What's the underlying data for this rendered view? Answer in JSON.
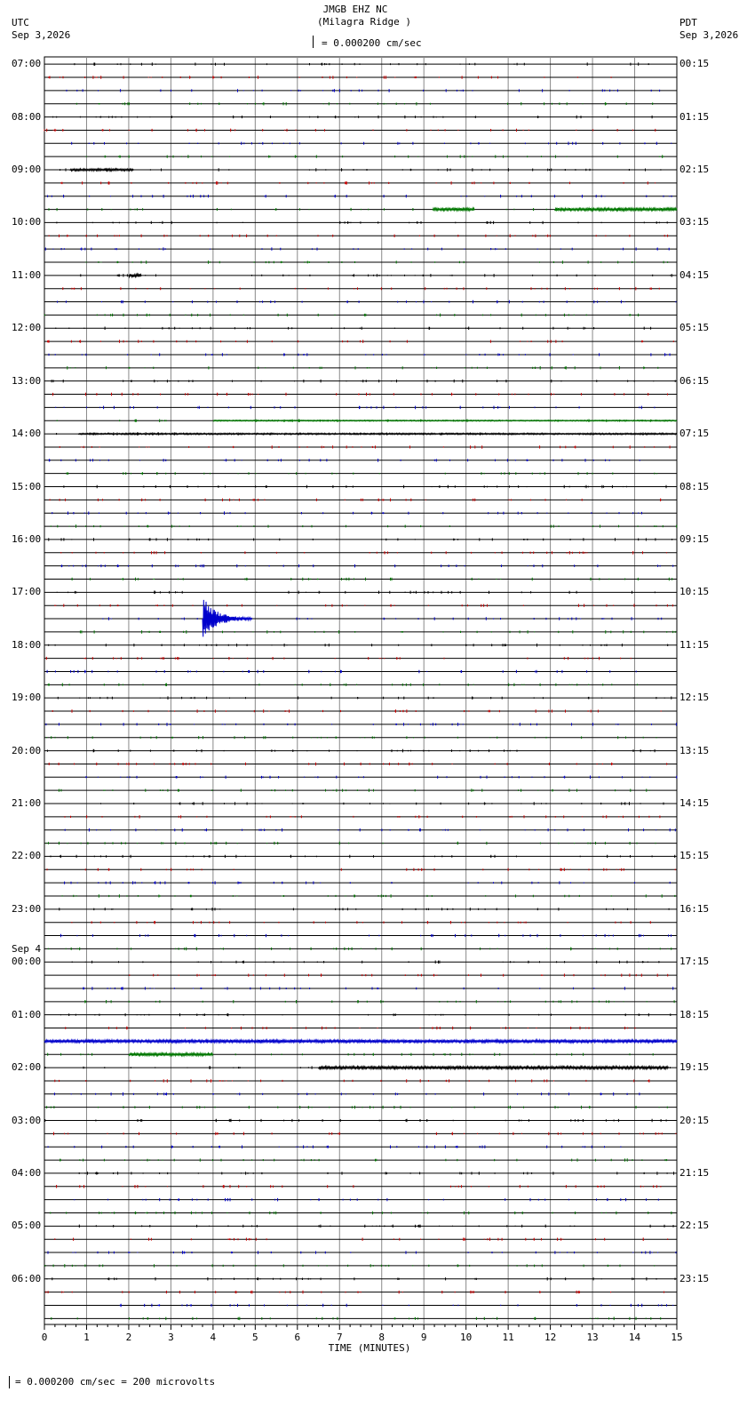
{
  "header": {
    "station": "JMGB EHZ NC",
    "location": "(Milagra Ridge )",
    "scale": "= 0.000200 cm/sec",
    "left_tz": "UTC",
    "left_date": "Sep 3,2026",
    "right_tz": "PDT",
    "right_date": "Sep 3,2026"
  },
  "footer": {
    "scale_note": "= 0.000200 cm/sec =     200 microvolts"
  },
  "chart_data": {
    "type": "line",
    "xlabel": "TIME (MINUTES)",
    "xlim": [
      0,
      15
    ],
    "x_ticks": [
      "0",
      "1",
      "2",
      "3",
      "4",
      "5",
      "6",
      "7",
      "8",
      "9",
      "10",
      "11",
      "12",
      "13",
      "14",
      "15"
    ],
    "trace_colors": [
      "#000000",
      "#cc0000",
      "#0000cc",
      "#007700"
    ],
    "left_labels": [
      {
        "row": 0,
        "text": "07:00"
      },
      {
        "row": 4,
        "text": "08:00"
      },
      {
        "row": 8,
        "text": "09:00"
      },
      {
        "row": 12,
        "text": "10:00"
      },
      {
        "row": 16,
        "text": "11:00"
      },
      {
        "row": 20,
        "text": "12:00"
      },
      {
        "row": 24,
        "text": "13:00"
      },
      {
        "row": 28,
        "text": "14:00"
      },
      {
        "row": 32,
        "text": "15:00"
      },
      {
        "row": 36,
        "text": "16:00"
      },
      {
        "row": 40,
        "text": "17:00"
      },
      {
        "row": 44,
        "text": "18:00"
      },
      {
        "row": 48,
        "text": "19:00"
      },
      {
        "row": 52,
        "text": "20:00"
      },
      {
        "row": 56,
        "text": "21:00"
      },
      {
        "row": 60,
        "text": "22:00"
      },
      {
        "row": 64,
        "text": "23:00"
      },
      {
        "row": 68,
        "text": "00:00",
        "date": "Sep 4"
      },
      {
        "row": 72,
        "text": "01:00"
      },
      {
        "row": 76,
        "text": "02:00"
      },
      {
        "row": 80,
        "text": "03:00"
      },
      {
        "row": 84,
        "text": "04:00"
      },
      {
        "row": 88,
        "text": "05:00"
      },
      {
        "row": 92,
        "text": "06:00"
      }
    ],
    "right_labels": [
      {
        "row": 0,
        "text": "00:15"
      },
      {
        "row": 4,
        "text": "01:15"
      },
      {
        "row": 8,
        "text": "02:15"
      },
      {
        "row": 12,
        "text": "03:15"
      },
      {
        "row": 16,
        "text": "04:15"
      },
      {
        "row": 20,
        "text": "05:15"
      },
      {
        "row": 24,
        "text": "06:15"
      },
      {
        "row": 28,
        "text": "07:15"
      },
      {
        "row": 32,
        "text": "08:15"
      },
      {
        "row": 36,
        "text": "09:15"
      },
      {
        "row": 40,
        "text": "10:15"
      },
      {
        "row": 44,
        "text": "11:15"
      },
      {
        "row": 48,
        "text": "12:15"
      },
      {
        "row": 52,
        "text": "13:15"
      },
      {
        "row": 56,
        "text": "14:15"
      },
      {
        "row": 60,
        "text": "15:15"
      },
      {
        "row": 64,
        "text": "16:15"
      },
      {
        "row": 68,
        "text": "17:15"
      },
      {
        "row": 72,
        "text": "18:15"
      },
      {
        "row": 76,
        "text": "19:15"
      },
      {
        "row": 80,
        "text": "20:15"
      },
      {
        "row": 84,
        "text": "21:15"
      },
      {
        "row": 88,
        "text": "22:15"
      },
      {
        "row": 92,
        "text": "23:15"
      }
    ],
    "rows": 96,
    "events": [
      {
        "row": 8,
        "x_start": 0.6,
        "x_end": 2.1,
        "amplitude": 1.2,
        "color": "#000000"
      },
      {
        "row": 11,
        "x_start": 9.2,
        "x_end": 10.2,
        "amplitude": 1.5,
        "color": "#007700"
      },
      {
        "row": 11,
        "x_start": 12.1,
        "x_end": 15.0,
        "amplitude": 1.5,
        "color": "#007700"
      },
      {
        "row": 16,
        "x_start": 2.0,
        "x_end": 2.3,
        "amplitude": 2.0,
        "color": "#000000"
      },
      {
        "row": 27,
        "x_start": 4.0,
        "x_end": 15.0,
        "amplitude": 0.6,
        "color": "#007700"
      },
      {
        "row": 28,
        "x_start": 0.8,
        "x_end": 15.0,
        "amplitude": 0.8,
        "color": "#000000"
      },
      {
        "row": 42,
        "x_start": 3.75,
        "x_end": 4.9,
        "amplitude": 25,
        "color": "#0000cc"
      },
      {
        "row": 74,
        "x_start": 0.0,
        "x_end": 15.0,
        "amplitude": 1.5,
        "color": "#0000cc"
      },
      {
        "row": 75,
        "x_start": 2.0,
        "x_end": 4.0,
        "amplitude": 1.5,
        "color": "#007700"
      },
      {
        "row": 76,
        "x_start": 6.5,
        "x_end": 14.8,
        "amplitude": 1.5,
        "color": "#000000"
      }
    ]
  }
}
